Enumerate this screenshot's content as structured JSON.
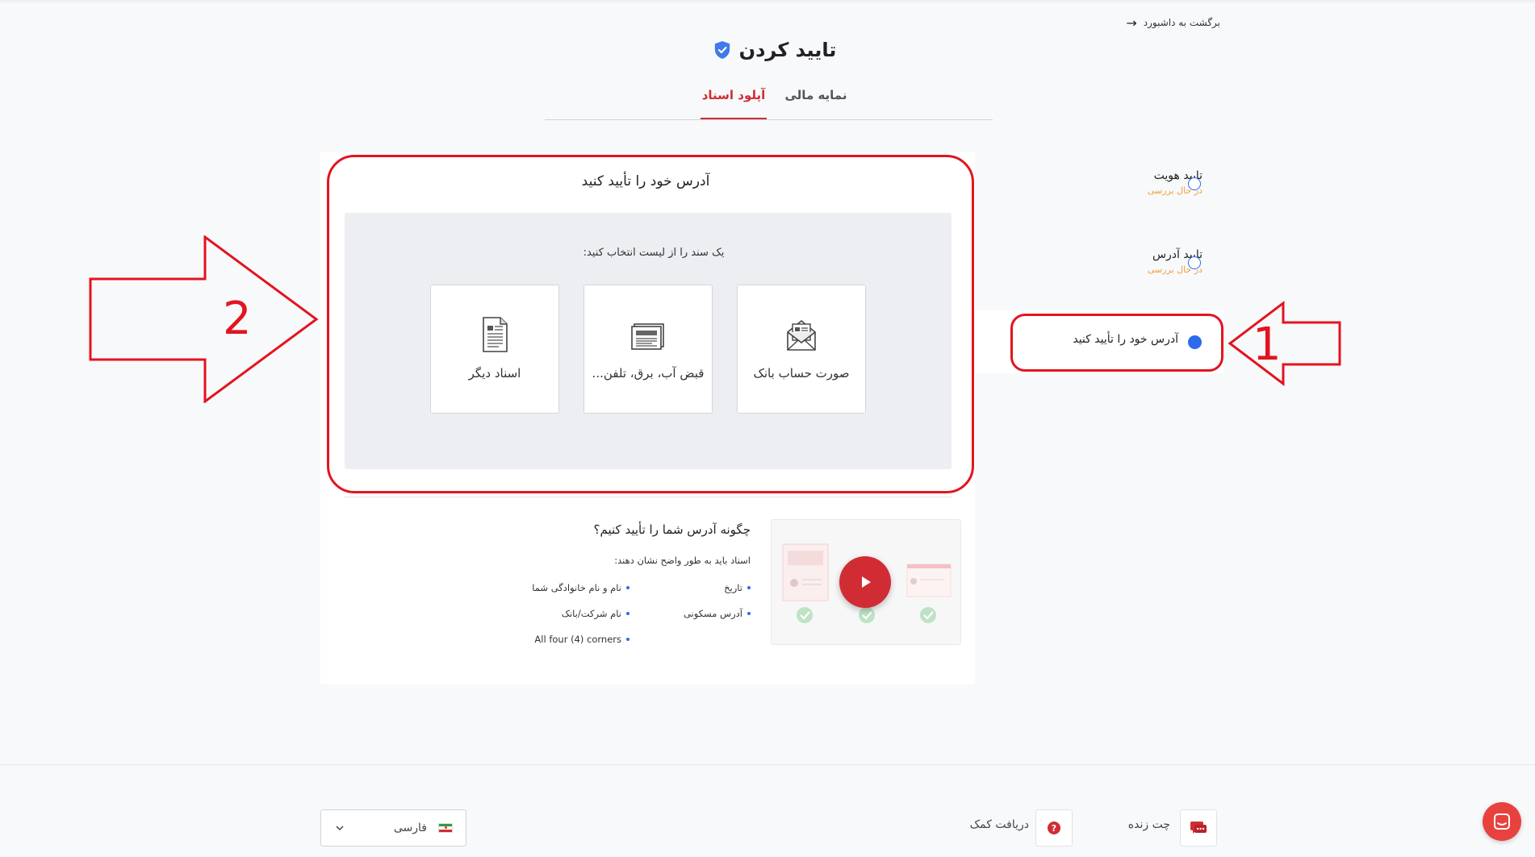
{
  "header": {
    "back_link": "برگشت به داشبورد",
    "title": "تایید کردن"
  },
  "tabs": [
    {
      "label": "نمایه مالی",
      "active": false
    },
    {
      "label": "آپلود اسناد",
      "active": true
    }
  ],
  "main": {
    "heading": "آدرس خود را تأیید کنید",
    "instruction": "یک سند را از لیست انتخاب کنید:",
    "documents": [
      {
        "label": "صورت حساب بانک",
        "icon": "envelope-document-icon"
      },
      {
        "label": "قبض آب، برق، تلفن...",
        "icon": "bill-icon"
      },
      {
        "label": "اسناد دیگر",
        "icon": "document-icon"
      }
    ],
    "how_to": {
      "title": "چگونه آدرس شما را تأیید کنیم؟",
      "subtitle": "اسناد باید به طور واضح نشان دهند:",
      "requirements": {
        "date": "تاریخ",
        "full_name": "نام و نام خانوادگی شما",
        "address": "آدرس مسکونی",
        "company": "نام شرکت/بانک",
        "corners": "All four (4) corners"
      }
    }
  },
  "steps": [
    {
      "title": "تایید هویت",
      "status": "در حال بررسی",
      "active": false
    },
    {
      "title": "تایید آدرس",
      "status": "در حال بررسی",
      "active": false
    },
    {
      "title": "آدرس خود را تأیید کنید",
      "status": "",
      "active": true
    }
  ],
  "annotations": {
    "number_1": "1",
    "number_2": "2",
    "color": "#e3141f"
  },
  "footer": {
    "language": "فارسی",
    "help_label": "دریافت کمک",
    "chat_label": "چت زنده"
  },
  "colors": {
    "accent_red": "#d12c34",
    "accent_blue": "#2c6bed",
    "status_orange": "#f2a03d"
  }
}
